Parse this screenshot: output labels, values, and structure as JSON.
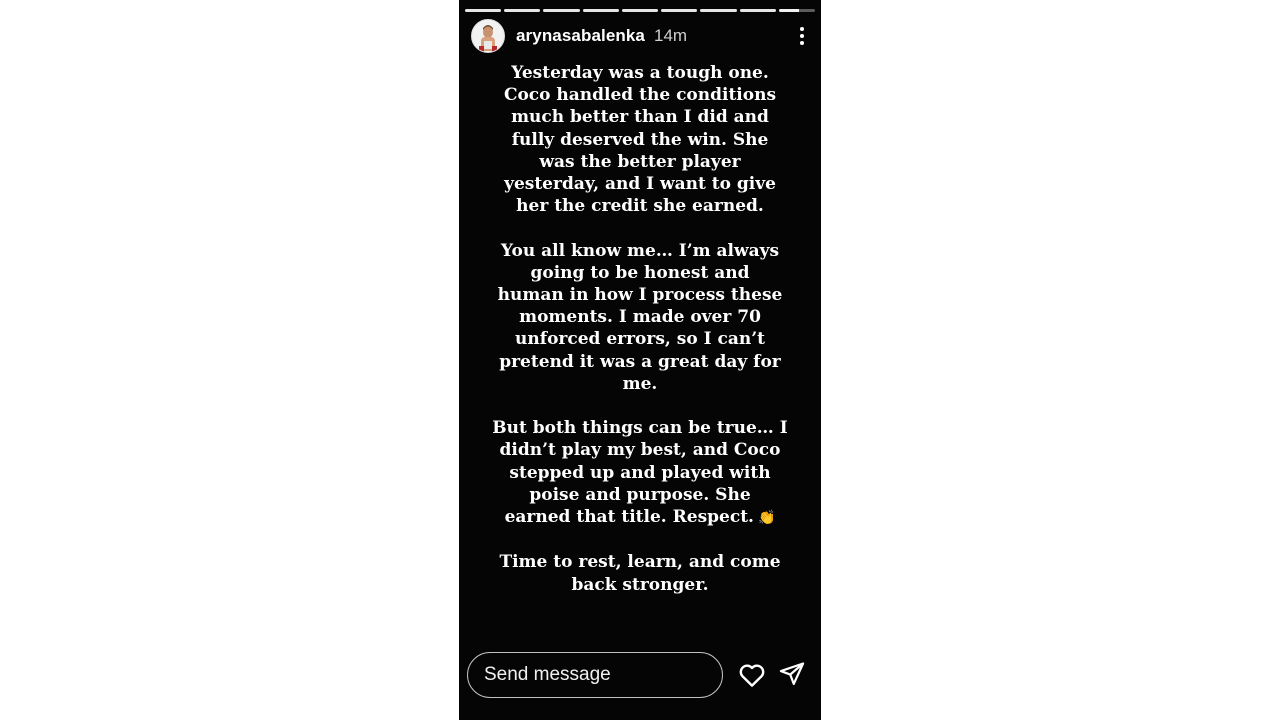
{
  "story": {
    "username": "arynasabalenka",
    "time": "14m",
    "segments": 9,
    "paragraphs": [
      "Yesterday was a tough one.\nCoco handled the conditions\nmuch better than I did and\nfully deserved the win. She\nwas the better player\nyesterday, and I want to give\nher the credit she earned.",
      "You all know me… I’m always\ngoing to be honest and\nhuman in how I process these\nmoments. I made over 70\nunforced errors, so I can’t\npretend it was a great day for\nme.",
      "But both things can be true… I\ndidn’t play my best, and Coco\nstepped up and played with\npoise and purpose. She\nearned that title. Respect.",
      "Time to rest, learn, and come\nback stronger."
    ],
    "emoji": "👏"
  },
  "footer": {
    "message_placeholder": "Send message"
  },
  "icons": {
    "more": "more-icon",
    "like": "heart-icon",
    "share": "send-icon"
  }
}
